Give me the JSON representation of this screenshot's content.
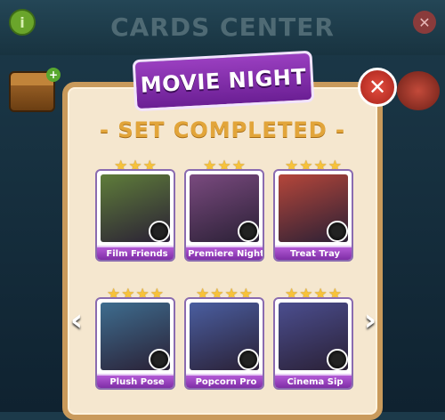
{
  "background": {
    "title": "CARDS CENTER",
    "info_icon_glyph": "i",
    "close_icon_glyph": "✕"
  },
  "dialog": {
    "ribbon_title": "MOVIE NIGHT",
    "subtitle": "- SET COMPLETED -",
    "close_glyph": "✕",
    "prev_glyph": "‹",
    "next_glyph": "›"
  },
  "cards": [
    {
      "label": "Film Friends",
      "stars": 3,
      "art_color": "#5f7d3a"
    },
    {
      "label": "Premiere Night",
      "stars": 3,
      "art_color": "#7a4a7f"
    },
    {
      "label": "Treat Tray",
      "stars": 4,
      "art_color": "#b5463a"
    },
    {
      "label": "Plush Pose",
      "stars": 4,
      "art_color": "#3e6d8f"
    },
    {
      "label": "Popcorn Pro",
      "stars": 4,
      "art_color": "#4a5ea0"
    },
    {
      "label": "Cinema Sip",
      "stars": 4,
      "art_color": "#4b4e8f"
    }
  ],
  "colors": {
    "accent_purple": "#8a3bb8",
    "gold": "#e2a53a",
    "panel": "#f5e7cf"
  }
}
